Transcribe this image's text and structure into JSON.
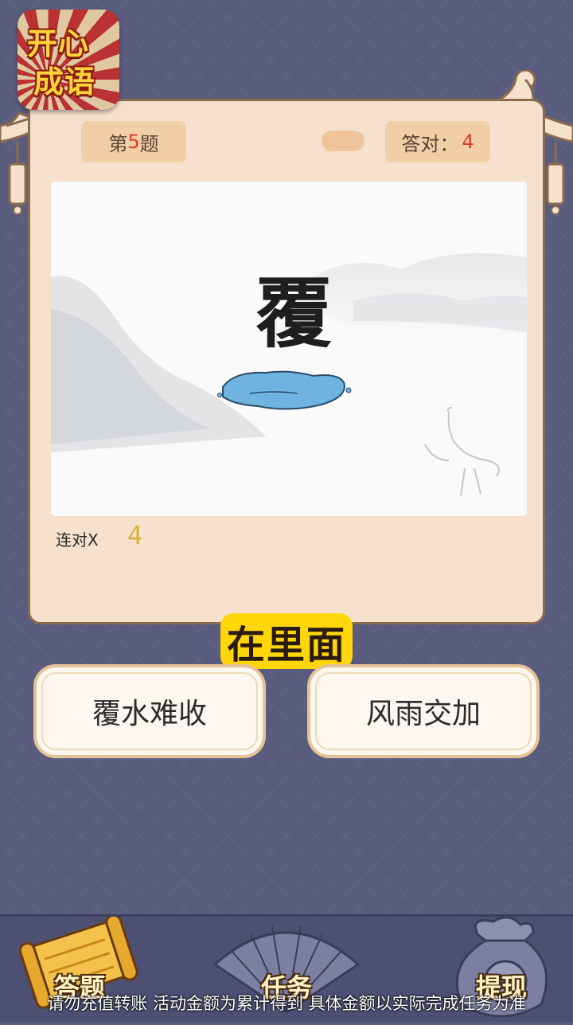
{
  "logo": {
    "line1": "开心",
    "line2": "成语"
  },
  "header": {
    "question_prefix": "第",
    "question_number": "5",
    "question_suffix": "题",
    "correct_label": "答对：",
    "correct_count": "4"
  },
  "puzzle": {
    "character": "覆"
  },
  "streak": {
    "label": "连对X",
    "value": "4"
  },
  "hint_text": "在里面",
  "answers": [
    "覆水难收",
    "风雨交加"
  ],
  "bottom_nav": [
    {
      "label": "答题",
      "icon": "scroll-icon"
    },
    {
      "label": "任务",
      "icon": "fan-icon"
    },
    {
      "label": "提现",
      "icon": "money-bag-icon"
    }
  ],
  "disclaimer": "请勿充值转账  活动金额为累计得到  具体金额以实际完成任务为准",
  "colors": {
    "background": "#5a5c7e",
    "panel": "#f6e2cc",
    "accent_red": "#e03a2c",
    "hint_yellow": "#ffd60a"
  }
}
